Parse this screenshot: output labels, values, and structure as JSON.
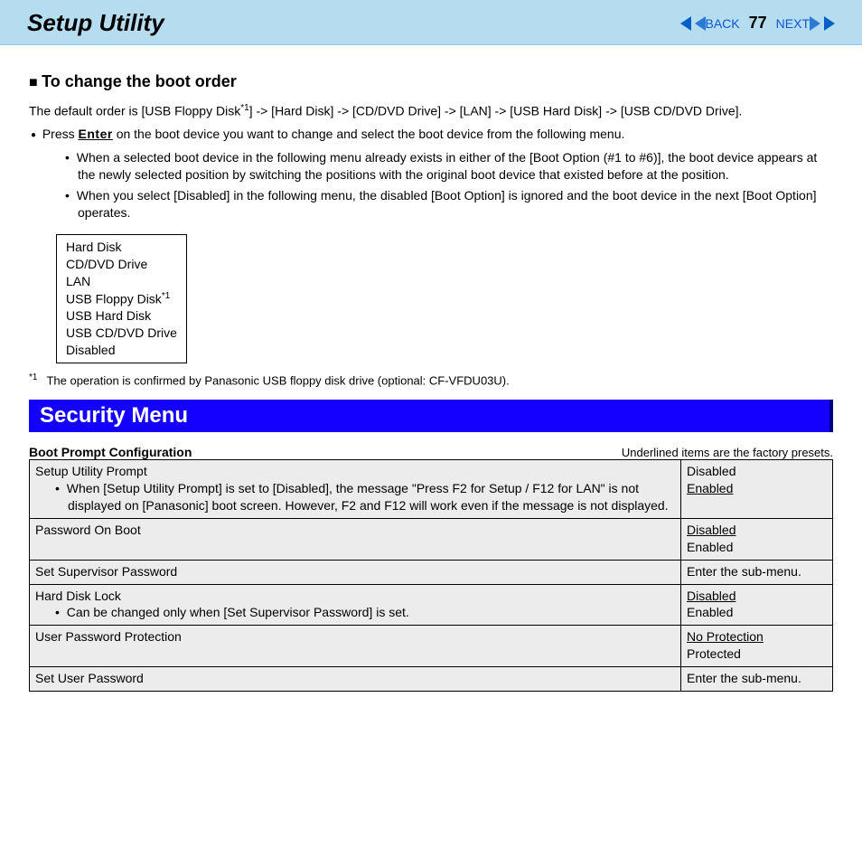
{
  "header": {
    "title": "Setup Utility",
    "back": "BACK",
    "next": "NEXT",
    "page": "77"
  },
  "boot": {
    "heading": "To change the boot order",
    "default_order": "The default order is [USB Floppy Disk",
    "default_order_sup": "*1",
    "default_order_rest": "] -> [Hard Disk] -> [CD/DVD Drive] -> [LAN] -> [USB Hard Disk] -> [USB CD/DVD Drive].",
    "press_pre": "Press ",
    "enter_key": "Enter",
    "press_post": " on the boot device you want to change and select the boot device from the following menu.",
    "sub1": "When a selected boot device in the following menu already exists in either of the [Boot Option (#1 to #6)], the boot device appears at the newly selected position by switching the positions with the original boot device that existed before at the position.",
    "sub2": "When you select [Disabled] in the following menu, the disabled [Boot Option] is ignored and the boot device in the next [Boot Option] operates.",
    "menu": {
      "item1": "Hard Disk",
      "item2": "CD/DVD Drive",
      "item3": "LAN",
      "item4_pre": "USB Floppy Disk",
      "item4_sup": "*1",
      "item5": "USB Hard Disk",
      "item6": "USB CD/DVD Drive",
      "item7": "Disabled"
    },
    "footnote_sup": "*1",
    "footnote": "The operation is confirmed by Panasonic USB floppy disk drive (optional: CF-VFDU03U)."
  },
  "security": {
    "title": "Security Menu",
    "config_heading": "Boot Prompt Configuration",
    "preset_note": "Underlined items are the factory presets.",
    "rows": {
      "r1": {
        "label": "Setup Utility Prompt",
        "note": "When [Setup Utility Prompt] is set to [Disabled], the message \"Press F2 for Setup / F12 for LAN\" is not displayed on [Panasonic] boot screen. However, F2 and F12 will work even if the message is not displayed.",
        "v1": "Disabled",
        "v2": "Enabled"
      },
      "r2": {
        "label": "Password On Boot",
        "v1": "Disabled",
        "v2": "Enabled"
      },
      "r3": {
        "label": "Set Supervisor Password",
        "v": "Enter the sub-menu."
      },
      "r4": {
        "label": "Hard Disk Lock",
        "note": "Can be changed only when [Set Supervisor Password] is set.",
        "v1": "Disabled",
        "v2": "Enabled"
      },
      "r5": {
        "label": "User Password Protection",
        "v1": "No Protection",
        "v2": "Protected"
      },
      "r6": {
        "label": "Set User Password",
        "v": "Enter the sub-menu."
      }
    }
  }
}
